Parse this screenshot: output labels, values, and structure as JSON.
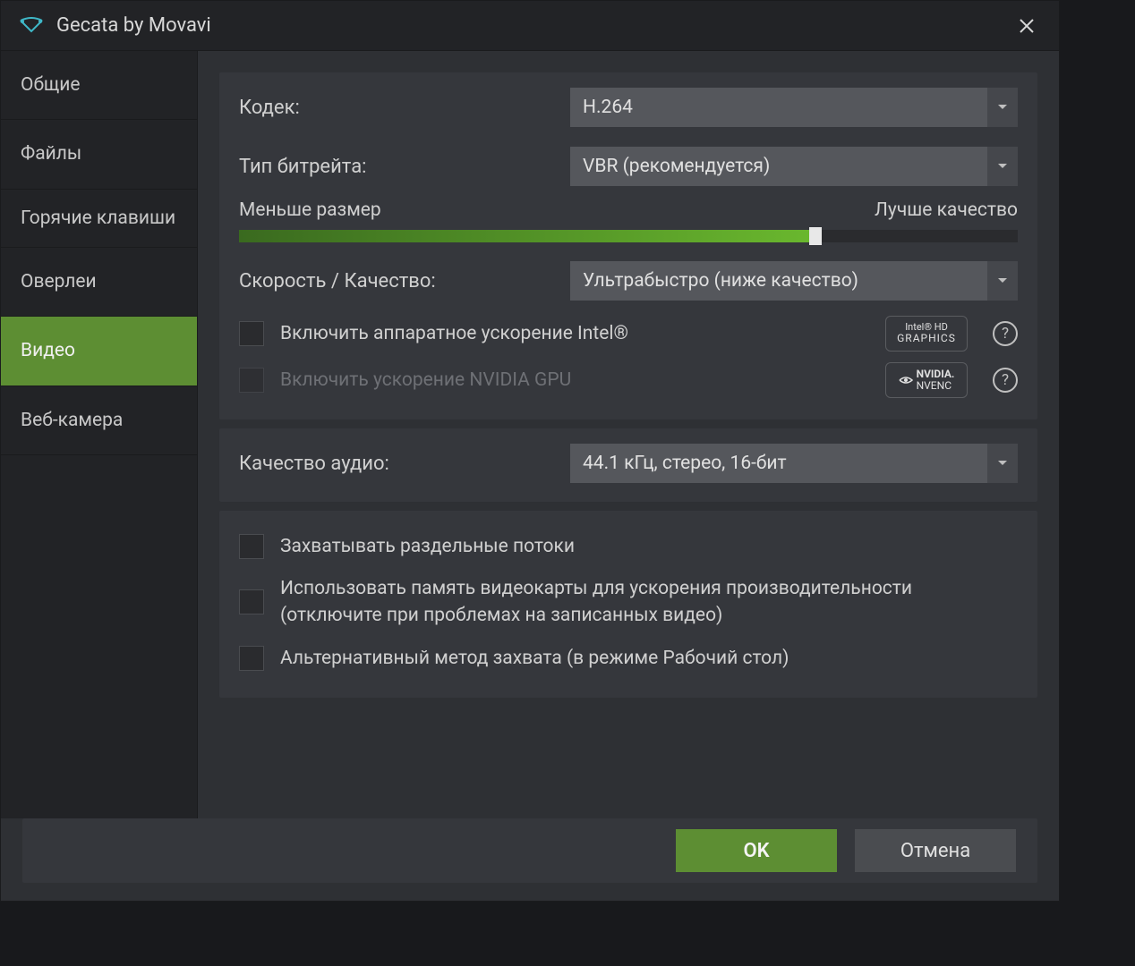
{
  "titlebar": {
    "title": "Gecata by Movavi"
  },
  "sidebar": {
    "items": [
      {
        "label": "Общие"
      },
      {
        "label": "Файлы"
      },
      {
        "label": "Горячие клавиши"
      },
      {
        "label": "Оверлеи"
      },
      {
        "label": "Видео"
      },
      {
        "label": "Веб-камера"
      }
    ]
  },
  "video": {
    "codec_label": "Кодек:",
    "codec_value": "H.264",
    "bitrate_label": "Тип битрейта:",
    "bitrate_value": "VBR (рекомендуется)",
    "slider_left": "Меньше размер",
    "slider_right": "Лучше качество",
    "speed_label": "Скорость / Качество:",
    "speed_value": "Ультрабыстро (ниже качество)",
    "hw_intel": "Включить аппаратное ускорение Intel®",
    "hw_nvidia": "Включить ускорение NVIDIA GPU",
    "intel_badge_top": "Intel® HD",
    "intel_badge_bot": "GRAPHICS",
    "nvidia_badge_top": "NVIDIA.",
    "nvidia_badge_bot": "NVENC",
    "audio_label": "Качество аудио:",
    "audio_value": "44.1 кГц, стерео, 16-бит",
    "cap_separate": "Захватывать раздельные потоки",
    "gpu_mem": "Использовать память видеокарты для ускорения производительности (отключите при проблемах на записанных видео)",
    "alt_method": "Альтернативный метод захвата (в режиме Рабочий стол)"
  },
  "footer": {
    "ok": "OK",
    "cancel": "Отмена"
  }
}
